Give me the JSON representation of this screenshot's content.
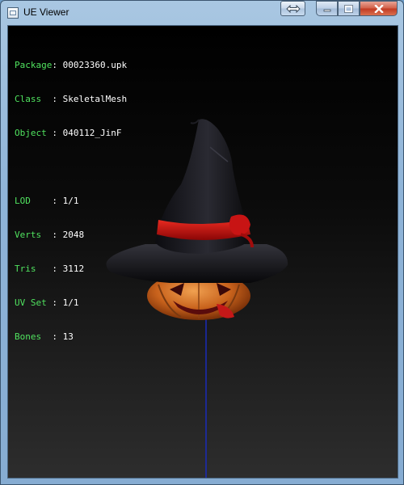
{
  "window": {
    "title": "UE Viewer"
  },
  "info": {
    "package": {
      "label": "Package",
      "sep": ": ",
      "value": "00023360.upk"
    },
    "class": {
      "label": "Class  ",
      "sep": ": ",
      "value": "SkeletalMesh"
    },
    "object": {
      "label": "Object ",
      "sep": ": ",
      "value": "040112_JinF"
    },
    "lod": {
      "label": "LOD    ",
      "sep": ": ",
      "value": "1/1"
    },
    "verts": {
      "label": "Verts  ",
      "sep": ": ",
      "value": "2048"
    },
    "tris": {
      "label": "Tris   ",
      "sep": ": ",
      "value": "3112"
    },
    "uvset": {
      "label": "UV Set ",
      "sep": ": ",
      "value": "1/1"
    },
    "bones": {
      "label": "Bones  ",
      "sep": ": ",
      "value": "13"
    }
  },
  "colors": {
    "label": "#50e35f",
    "value": "#ffffff",
    "axis": "#1a2bb8",
    "hat": "#17171b",
    "band": "#c41010",
    "pumpkin": "#d06a1e"
  },
  "icons": {
    "swap": "swap-arrows-icon",
    "minimize": "minimize-icon",
    "maximize": "maximize-icon",
    "close": "close-icon"
  }
}
